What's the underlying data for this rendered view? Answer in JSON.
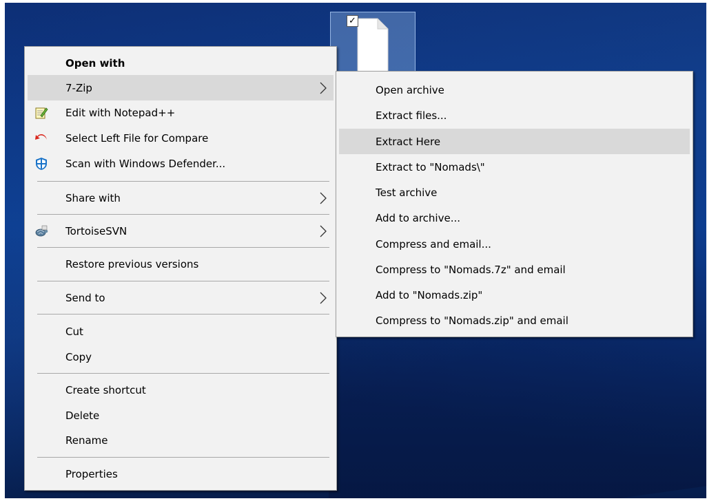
{
  "desktop_file": {
    "checkbox": "✓"
  },
  "main_menu": {
    "items": [
      {
        "label": "Open with"
      },
      {
        "label": "7-Zip"
      },
      {
        "label": "Edit with Notepad++"
      },
      {
        "label": "Select Left File for Compare"
      },
      {
        "label": "Scan with Windows Defender..."
      },
      {
        "label": "Share with"
      },
      {
        "label": "TortoiseSVN"
      },
      {
        "label": "Restore previous versions"
      },
      {
        "label": "Send to"
      },
      {
        "label": "Cut"
      },
      {
        "label": "Copy"
      },
      {
        "label": "Create shortcut"
      },
      {
        "label": "Delete"
      },
      {
        "label": "Rename"
      },
      {
        "label": "Properties"
      }
    ]
  },
  "sub_menu": {
    "items": [
      {
        "label": "Open archive"
      },
      {
        "label": "Extract files..."
      },
      {
        "label": "Extract Here"
      },
      {
        "label": "Extract to \"Nomads\\\""
      },
      {
        "label": "Test archive"
      },
      {
        "label": "Add to archive..."
      },
      {
        "label": "Compress and email..."
      },
      {
        "label": "Compress to \"Nomads.7z\" and email"
      },
      {
        "label": "Add to \"Nomads.zip\""
      },
      {
        "label": "Compress to \"Nomads.zip\" and email"
      }
    ]
  },
  "colors": {
    "menu_bg": "#f2f2f2",
    "highlight": "#d9d9d9",
    "desktop": "#0b3a8c"
  },
  "icons": [
    "notepad-plus-plus-icon",
    "compare-arrow-icon",
    "windows-defender-shield-icon",
    "tortoisesvn-icon",
    "submenu-arrow-icon",
    "document-icon"
  ]
}
